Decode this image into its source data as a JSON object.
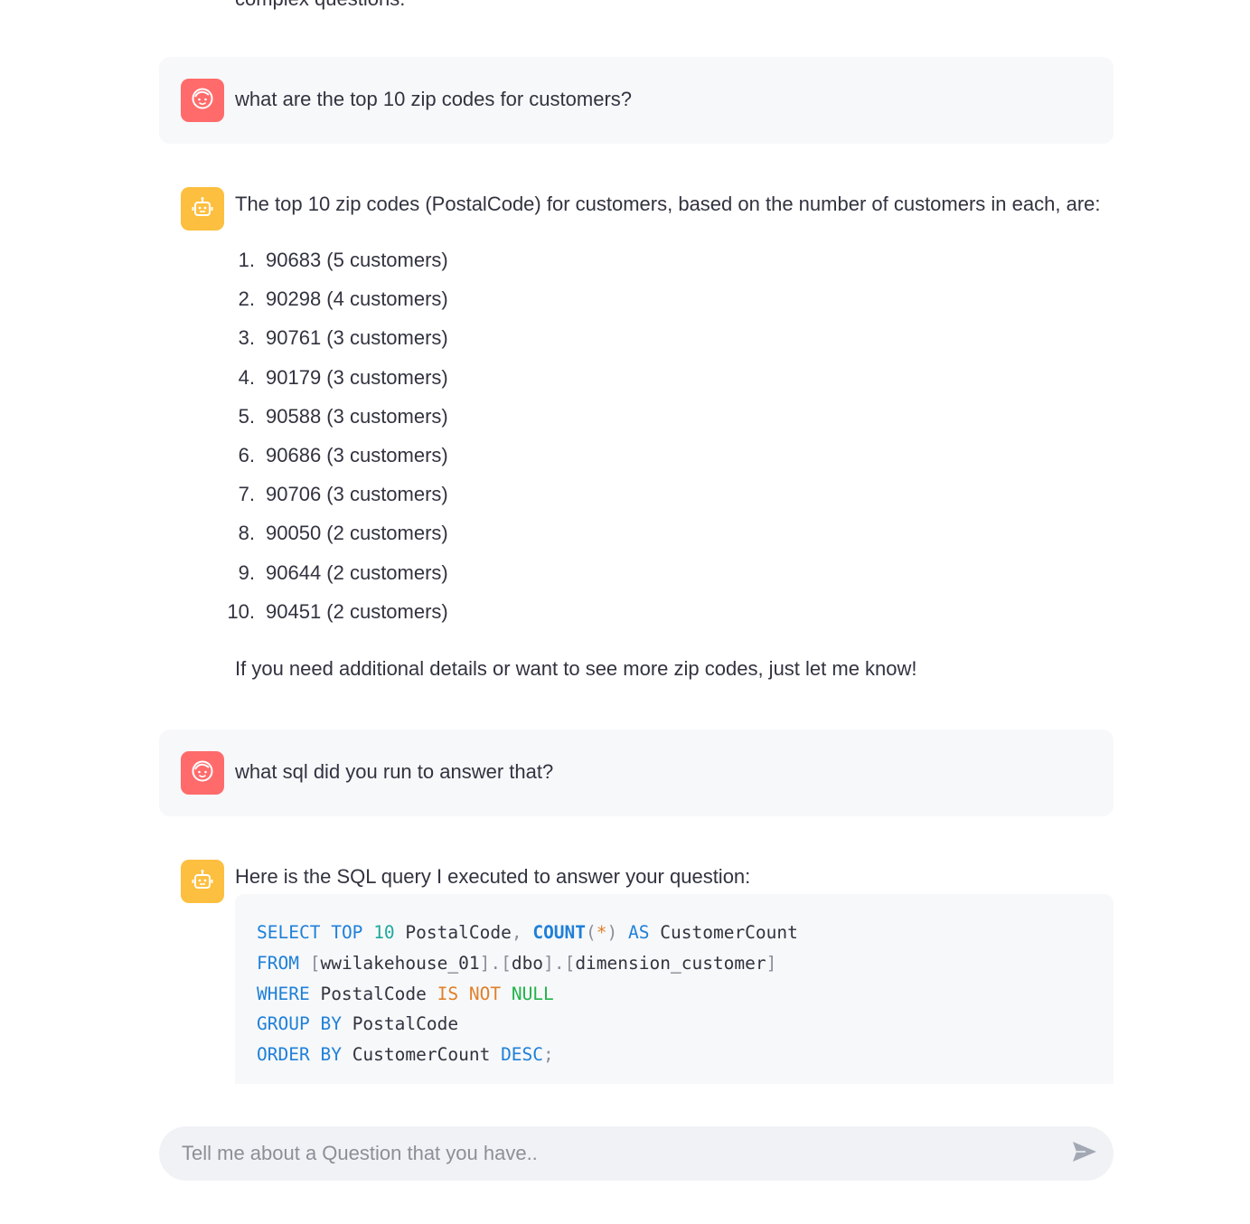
{
  "intro_tail": "complex questions.",
  "messages": [
    {
      "role": "user",
      "avatar_icon": "user-face-icon",
      "text": "what are the top 10 zip codes for customers?"
    },
    {
      "role": "assistant",
      "avatar_icon": "robot-icon",
      "text": "The top 10 zip codes (PostalCode) for customers, based on the number of customers in each, are:",
      "list": [
        {
          "num": "1.",
          "text": "90683 (5 customers)"
        },
        {
          "num": "2.",
          "text": "90298 (4 customers)"
        },
        {
          "num": "3.",
          "text": "90761 (3 customers)"
        },
        {
          "num": "4.",
          "text": "90179 (3 customers)"
        },
        {
          "num": "5.",
          "text": "90588 (3 customers)"
        },
        {
          "num": "6.",
          "text": "90686 (3 customers)"
        },
        {
          "num": "7.",
          "text": "90706 (3 customers)"
        },
        {
          "num": "8.",
          "text": "90050 (2 customers)"
        },
        {
          "num": "9.",
          "text": "90644 (2 customers)"
        },
        {
          "num": "10.",
          "text": "90451 (2 customers)"
        }
      ],
      "footer": "If you need additional details or want to see more zip codes, just let me know!"
    },
    {
      "role": "user",
      "avatar_icon": "user-face-icon",
      "text": "what sql did you run to answer that?"
    },
    {
      "role": "assistant",
      "avatar_icon": "robot-icon",
      "text": "Here is the SQL query I executed to answer your question:",
      "code": {
        "language": "sql",
        "lines": [
          "SELECT TOP 10 PostalCode, COUNT(*) AS CustomerCount",
          "FROM [wwilakehouse_01].[dbo].[dimension_customer]",
          "WHERE PostalCode IS NOT NULL",
          "GROUP BY PostalCode",
          "ORDER BY CustomerCount DESC;"
        ]
      }
    }
  ],
  "chat_input": {
    "placeholder": "Tell me about a Question that you have..",
    "value": "",
    "send_icon": "send-icon"
  },
  "colors": {
    "user_avatar": "#ff6b6b",
    "assistant_avatar": "#fdbf3f",
    "user_bubble": "#f7f8fa",
    "keyword": "#1f80d8"
  }
}
